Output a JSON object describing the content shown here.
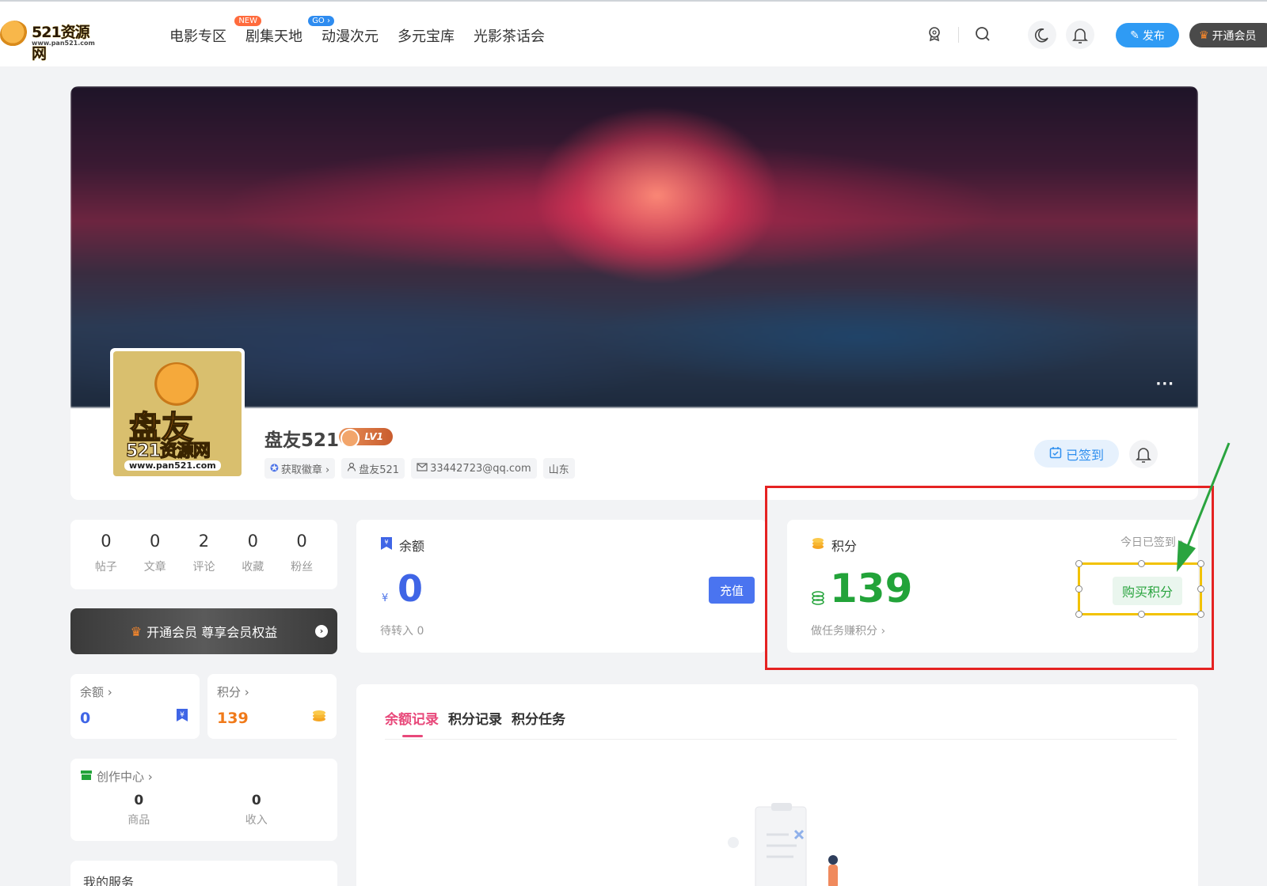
{
  "header": {
    "logo_brand": "521资源网",
    "logo_url": "www.pan521.com",
    "nav": [
      {
        "label": "电影专区",
        "tag": "NEW"
      },
      {
        "label": "剧集天地",
        "tag": "GO ›"
      },
      {
        "label": "动漫次元",
        "tag": ""
      },
      {
        "label": "多元宝库",
        "tag": ""
      },
      {
        "label": "光影茶话会",
        "tag": ""
      }
    ],
    "publish_label": "发布",
    "vip_label": "开通会员"
  },
  "profile": {
    "avatar": {
      "title": "盘友",
      "subtitle": "521资源网",
      "url": "www.pan521.com"
    },
    "username": "盘友521",
    "level": "LV1",
    "chips": {
      "badge": "获取徽章 ›",
      "nickname": "盘友521",
      "email": "33442723@qq.com",
      "location": "山东"
    },
    "signed_label": "已签到",
    "more": "···"
  },
  "stats": [
    {
      "value": "0",
      "label": "帖子"
    },
    {
      "value": "0",
      "label": "文章"
    },
    {
      "value": "2",
      "label": "评论"
    },
    {
      "value": "0",
      "label": "收藏"
    },
    {
      "value": "0",
      "label": "粉丝"
    }
  ],
  "vip_banner": {
    "label": "开通会员 尊享会员权益",
    "go": "›"
  },
  "mini_cards": {
    "balance": {
      "title": "余额 ›",
      "value": "0"
    },
    "points": {
      "title": "积分 ›",
      "value": "139"
    }
  },
  "creation": {
    "title": "创作中心 ›",
    "items": [
      {
        "value": "0",
        "label": "商品"
      },
      {
        "value": "0",
        "label": "收入"
      }
    ]
  },
  "services": {
    "title": "我的服务"
  },
  "balance": {
    "title": "余额",
    "currency": "¥",
    "amount": "0",
    "pending": "待转入 0",
    "recharge_label": "充值"
  },
  "points": {
    "title": "积分",
    "amount": "139",
    "task_link": "做任务赚积分 ›",
    "today": "今日已签到 ›",
    "buy_label": "购买积分"
  },
  "records": {
    "tabs": [
      "余额记录",
      "积分记录",
      "积分任务"
    ],
    "active_tab": 0
  },
  "colors": {
    "accent_blue": "#2f9bf4",
    "balance_blue": "#3f65e6",
    "points_green": "#22a339",
    "tab_pink": "#e8487a",
    "highlight_red": "#e52222",
    "selection_yellow": "#f2c200",
    "arrow_green": "#2aa43f"
  }
}
